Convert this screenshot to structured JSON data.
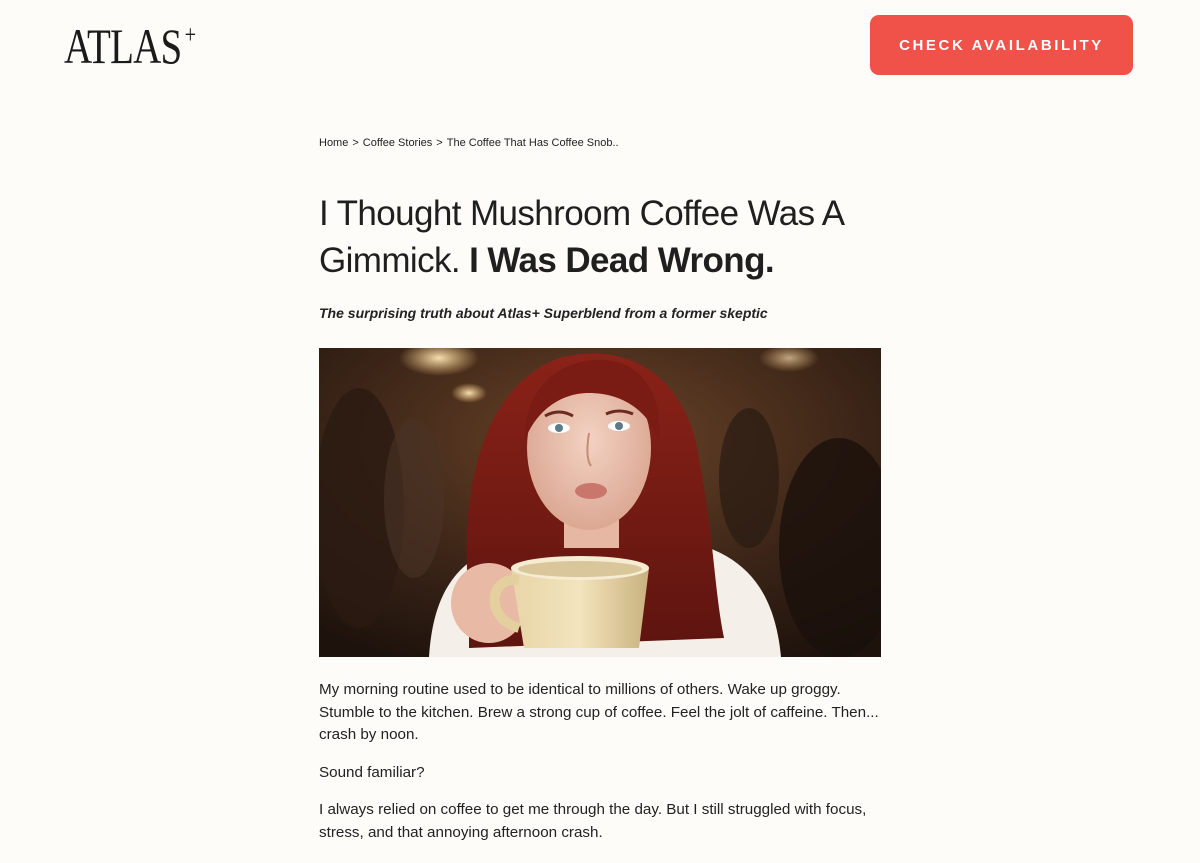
{
  "header": {
    "logo_text": "ATLAS",
    "logo_plus": "+",
    "cta_label": "CHECK AVAILABILITY"
  },
  "breadcrumb": {
    "items": [
      "Home",
      "Coffee Stories",
      "The Coffee That Has Coffee Snob.."
    ],
    "separator": ">"
  },
  "article": {
    "headline_regular": "I Thought Mushroom Coffee Was A Gimmick.",
    "headline_bold": "I Was Dead Wrong.",
    "subheadline": "The surprising truth about Atlas+ Superblend from a former skeptic",
    "paragraphs": [
      "My morning routine used to be identical to millions of others. Wake up groggy. Stumble to the kitchen. Brew a strong cup of coffee. Feel the jolt of caffeine. Then... crash by noon.",
      "Sound familiar?",
      "I always relied on coffee to get me through the day. But I still struggled with focus, stress, and that annoying afternoon crash."
    ]
  },
  "colors": {
    "accent": "#f0524a",
    "background": "#fdfcf8",
    "text": "#1a1a1a"
  }
}
